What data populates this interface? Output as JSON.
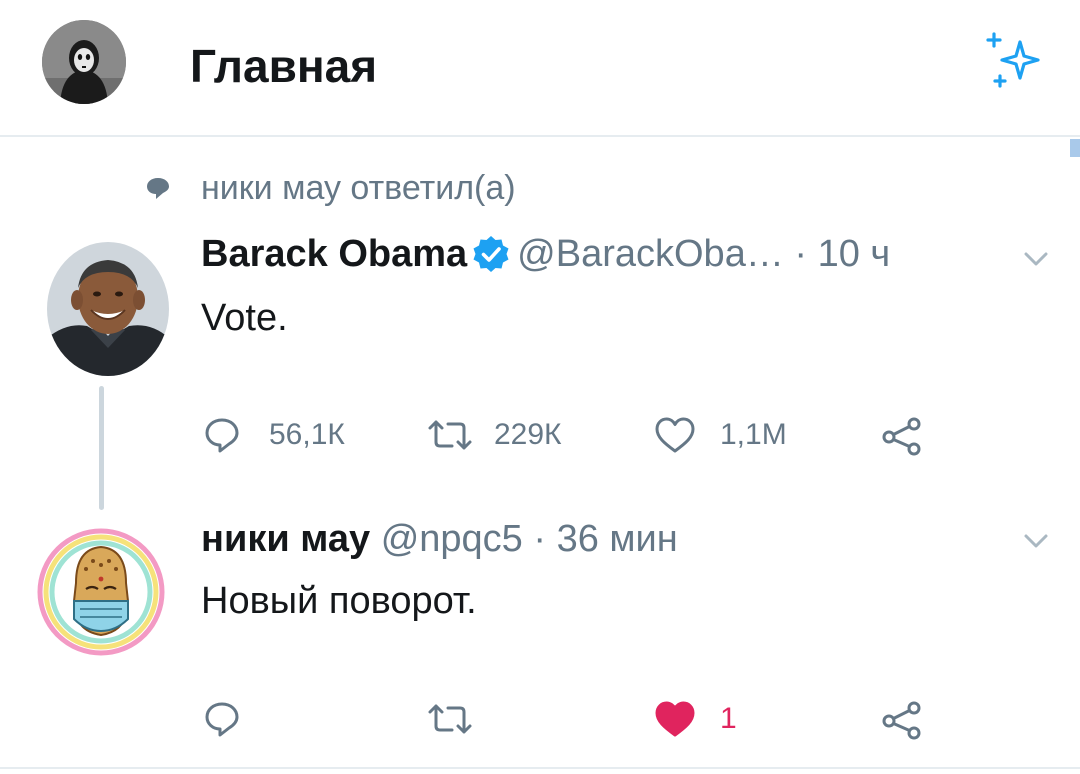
{
  "header": {
    "title": "Главная",
    "avatar_icon": "hooded-figure-avatar",
    "sparkle_icon": "sparkle-icon",
    "accent_color": "#1da1f2"
  },
  "context": {
    "text": "ники мау ответил(а)",
    "icon": "speech-bubble-icon"
  },
  "tweets": [
    {
      "name": "Barack Obama",
      "verified": true,
      "handle": "@BarackOba…",
      "separator": "·",
      "time": "10 ч",
      "text": "Vote.",
      "actions": {
        "reply": "56,1К",
        "retweet": "229К",
        "like": "1,1М",
        "liked": false
      }
    },
    {
      "name": "ники мау",
      "verified": false,
      "handle": "@npqc5",
      "separator": "·",
      "time": "36 мин",
      "text": "Новый поворот.",
      "actions": {
        "reply": "",
        "retweet": "",
        "like": "1",
        "liked": true
      }
    }
  ],
  "colors": {
    "like_active": "#e0245e",
    "muted": "#657786",
    "verified": "#1da1f2"
  }
}
